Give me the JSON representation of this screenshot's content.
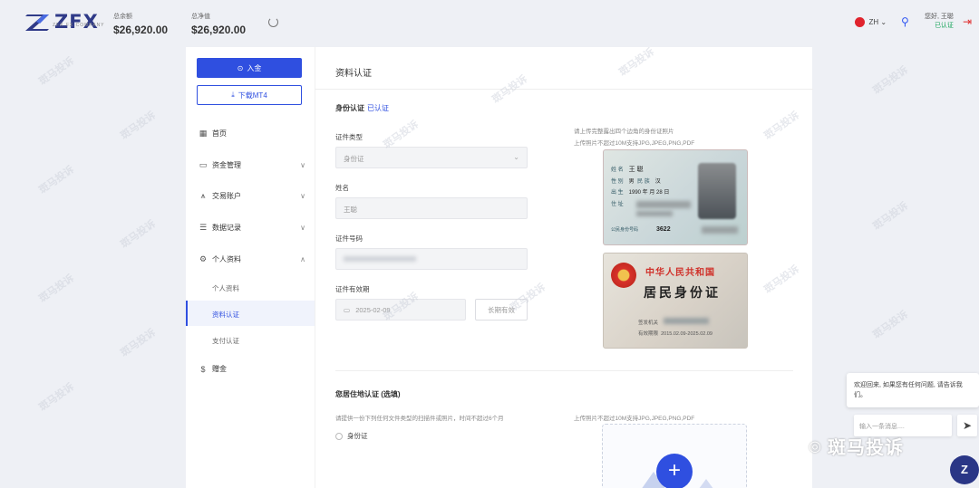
{
  "header": {
    "logo_text": "ZFX",
    "logo_sub": "ZFX FX COMPANY",
    "balance_label": "总余额",
    "balance_value": "$26,920.00",
    "equity_label": "总净值",
    "equity_value": "$26,920.00",
    "lang": "ZH",
    "greeting": "您好, 王聪",
    "verify_status": "已认证"
  },
  "sidebar": {
    "deposit_label": "入金",
    "download_label": "下载MT4",
    "items": [
      {
        "label": "首页",
        "icon": "grid-icon"
      },
      {
        "label": "资金管理",
        "icon": "wallet-icon"
      },
      {
        "label": "交易账户",
        "icon": "chart-icon"
      },
      {
        "label": "数据记录",
        "icon": "list-icon"
      },
      {
        "label": "个人资料",
        "icon": "gear-icon"
      }
    ],
    "sub_items": [
      {
        "label": "个人资料"
      },
      {
        "label": "资料认证"
      },
      {
        "label": "支付认证"
      }
    ],
    "rewards_label": "赠金"
  },
  "main": {
    "title": "资料认证",
    "id_section_title": "身份认证",
    "id_section_status": "已认证",
    "doc_type_label": "证件类型",
    "doc_type_value": "身份证",
    "name_label": "姓名",
    "name_value": "王聪",
    "id_number_label": "证件号码",
    "expiry_label": "证件有效期",
    "expiry_value": "2025-02-09",
    "longterm_label": "长期有效",
    "upload_hint_1": "请上传完整露出四个边角的身份证照片",
    "upload_hint_2": "上传照片不超过10M支持JPG,JPEG,PNG,PDF",
    "residence_title": "您居住地认证 (选填)",
    "residence_hint": "请提供一份下列任何文件类型的扫描件或照片，时间不超过6个月",
    "residence_upload_hint": "上传照片不超过10M支持JPG,JPEG,PNG,PDF",
    "residence_option": "身份证"
  },
  "id_front": {
    "name_label": "姓 名",
    "name_value": "王 聪",
    "sex_label": "性 别",
    "sex_value": "男",
    "ethnic_label": "民 族",
    "ethnic_value": "汉",
    "birth_label": "出 生",
    "birth_value": "1990 年 月 28 日",
    "address_label": "住 址",
    "number_label": "公民身份号码",
    "number_value": "3622"
  },
  "id_back": {
    "title1": "中华人民共和国",
    "title2": "居民身份证",
    "issuer_label": "签发机关",
    "validity_label": "有效期限",
    "validity_value": "2015.02.09-2025.02.09"
  },
  "chat": {
    "message": "欢迎回来, 如果您有任何问题, 请告诉我们。",
    "placeholder": "输入一条消息...."
  },
  "watermark": {
    "label": "斑马投诉",
    "tile": "斑马投诉"
  }
}
